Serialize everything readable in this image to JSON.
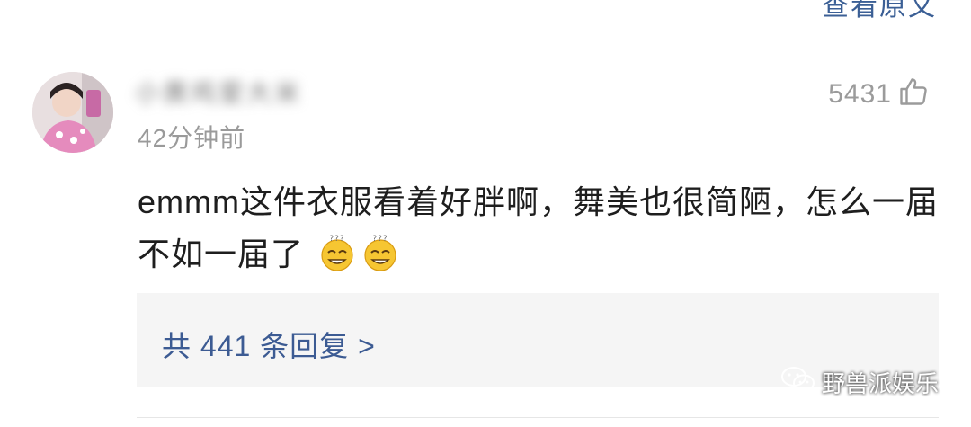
{
  "header": {
    "link_label": "查看原文"
  },
  "comment": {
    "username": "小黄鸡爱大米",
    "timestamp": "42分钟前",
    "like_count": "5431",
    "text": "emmm这件衣服看着好胖啊，舞美也很简陋，怎么一届不如一届了",
    "emojis": [
      "confused-face-emoji",
      "confused-face-emoji"
    ]
  },
  "replies": {
    "label": "共 441 条回复 >"
  },
  "watermark": {
    "label": "野兽派娱乐",
    "icon": "wechat-icon"
  },
  "colors": {
    "link": "#3c5b93",
    "meta_text": "#9a9a9a",
    "body_text": "#1e1e1e",
    "reply_bg": "#f5f5f5"
  }
}
